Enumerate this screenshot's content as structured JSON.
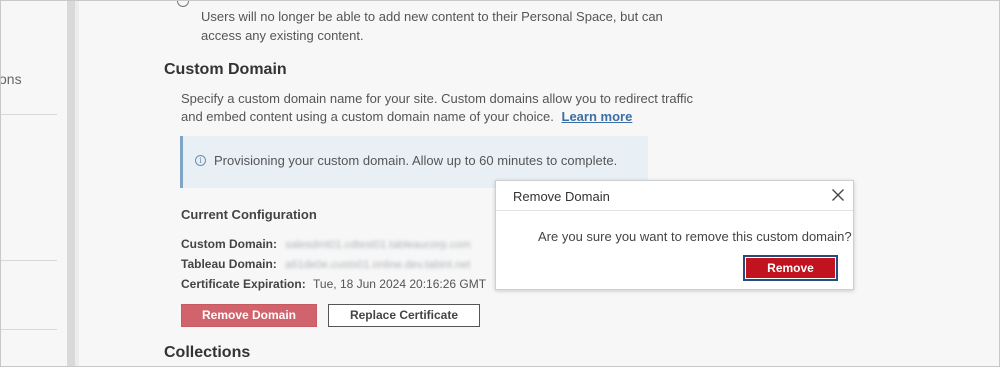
{
  "sidebar": {
    "partial_label": "ons"
  },
  "personal_space": {
    "description_line1": "Users will no longer be able to add new content to their Personal Space, but can",
    "description_line2": "access any existing content."
  },
  "custom_domain": {
    "title": "Custom Domain",
    "description_line1": "Specify a custom domain name for your site. Custom domains allow you to redirect traffic",
    "description_line2": "and embed content using a custom domain name of your choice.",
    "learn_more": "Learn more",
    "info_message": "Provisioning your custom domain. Allow up to 60 minutes to complete.",
    "current_config_title": "Current Configuration",
    "custom_domain_label": "Custom Domain:",
    "custom_domain_value": "salesdmt01.cdtest01.tableaucorp.com",
    "tableau_domain_label": "Tableau Domain:",
    "tableau_domain_value": "a61de0e.custo01.online.dev.tabint.net",
    "cert_expiration_label": "Certificate Expiration:",
    "cert_expiration_value": "Tue, 18 Jun 2024 20:16:26 GMT",
    "remove_domain_button": "Remove Domain",
    "replace_certificate_button": "Replace Certificate"
  },
  "collections": {
    "title": "Collections"
  },
  "modal": {
    "title": "Remove Domain",
    "message": "Are you sure you want to remove this custom domain?",
    "confirm_button": "Remove"
  },
  "colors": {
    "danger": "#c0121f",
    "danger_soft": "#d0636b",
    "link": "#3b6ea5",
    "info_bg": "#e8f0f6",
    "info_border": "#7ea4c6"
  },
  "icons": {
    "info": "info-icon",
    "close": "close-icon"
  }
}
